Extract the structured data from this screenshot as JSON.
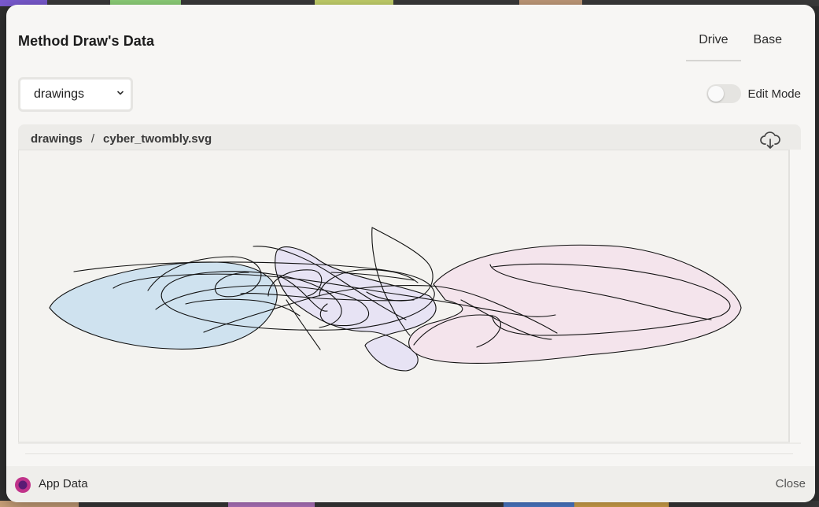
{
  "modal": {
    "title": "Method Draw's Data",
    "tabs": [
      {
        "label": "Drive",
        "active": true
      },
      {
        "label": "Base",
        "active": false
      }
    ]
  },
  "folder_select": {
    "selected": "drawings"
  },
  "edit_mode": {
    "label": "Edit Mode",
    "enabled": false
  },
  "viewer": {
    "breadcrumb_folder": "drawings",
    "breadcrumb_separator": "/",
    "breadcrumb_file": "cyber_twombly.svg",
    "download_icon": "cloud-download-icon"
  },
  "footer": {
    "app_label": "App Data",
    "close_label": "Close"
  },
  "colors": {
    "blue_fill": "#cfe2ef",
    "lavender_fill": "#e7e3f4",
    "pink_fill": "#f4e4ec",
    "app_icon": "#c0338a"
  }
}
